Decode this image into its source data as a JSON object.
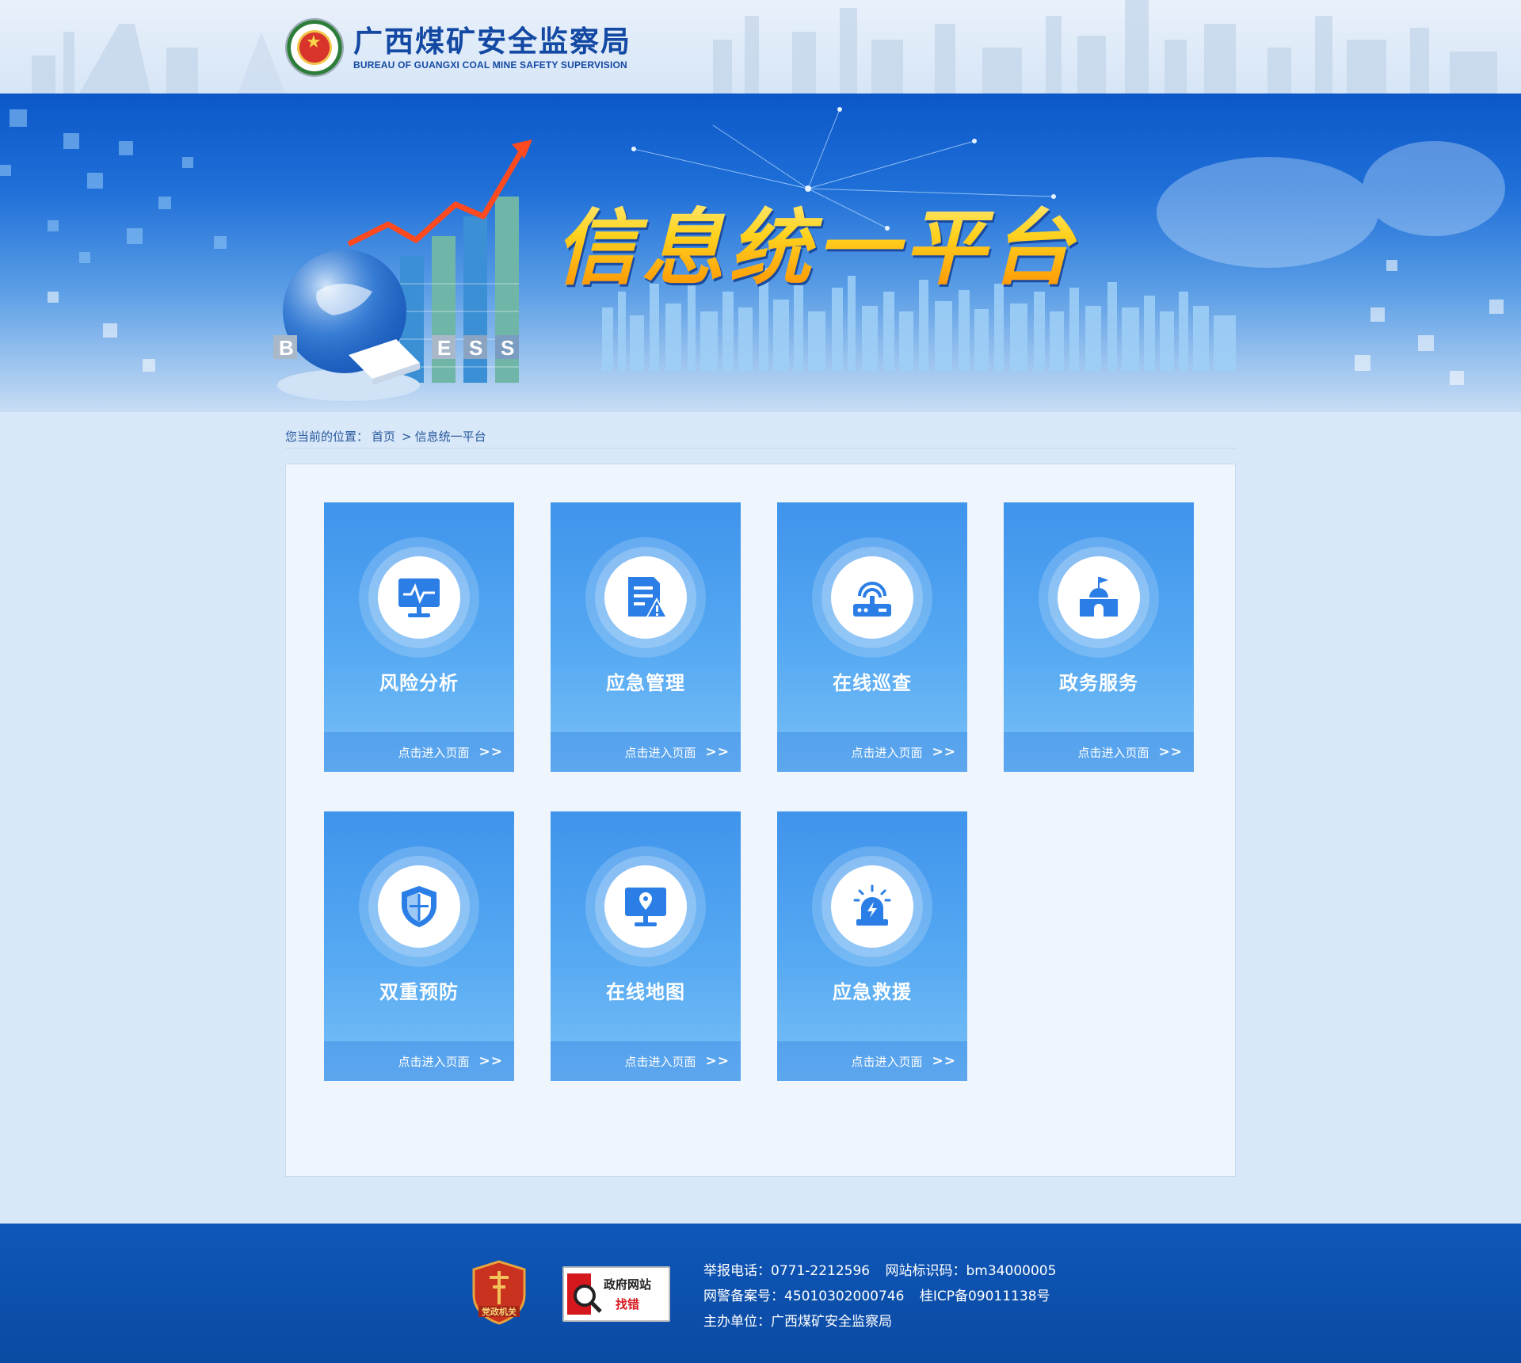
{
  "header": {
    "org_name_cn": "广西煤矿安全监察局",
    "org_name_en": "BUREAU OF GUANGXI COAL MINE SAFETY SUPERVISION",
    "emblem_icon": "national-emblem-icon"
  },
  "banner": {
    "title": "信息统一平台",
    "block_letters": [
      "B",
      "E",
      "S",
      "S"
    ]
  },
  "breadcrumb": {
    "prefix": "您当前的位置：",
    "home": "首页",
    "separator": ">",
    "current": "信息统一平台"
  },
  "cards": [
    {
      "label": "风险分析",
      "action": "点击进入页面",
      "arrow": ">>",
      "icon": "monitor-pulse-icon"
    },
    {
      "label": "应急管理",
      "action": "点击进入页面",
      "arrow": ">>",
      "icon": "document-warning-icon"
    },
    {
      "label": "在线巡查",
      "action": "点击进入页面",
      "arrow": ">>",
      "icon": "router-signal-icon"
    },
    {
      "label": "政务服务",
      "action": "点击进入页面",
      "arrow": ">>",
      "icon": "government-building-icon"
    },
    {
      "label": "双重预防",
      "action": "点击进入页面",
      "arrow": ">>",
      "icon": "shield-icon"
    },
    {
      "label": "在线地图",
      "action": "点击进入页面",
      "arrow": ">>",
      "icon": "map-monitor-icon"
    },
    {
      "label": "应急救援",
      "action": "点击进入页面",
      "arrow": ">>",
      "icon": "alarm-siren-icon"
    }
  ],
  "footer": {
    "badge1_label": "党政机关",
    "badge2_line1": "政府网站",
    "badge2_line2": "找错",
    "report_phone": "举报电话：0771-2212596",
    "site_code": "网站标识码：bm34000005",
    "police_record": "网警备案号：45010302000746",
    "icp_record": "桂ICP备09011138号",
    "sponsor": "主办单位：广西煤矿安全监察局"
  },
  "colors": {
    "brand_blue": "#1349a3",
    "card_top": "#3f94ec",
    "card_bottom": "#79c0f7",
    "footer_bg": "#0f57b8",
    "title_gold": "#ffd21f",
    "alert_red": "#d5181e"
  }
}
